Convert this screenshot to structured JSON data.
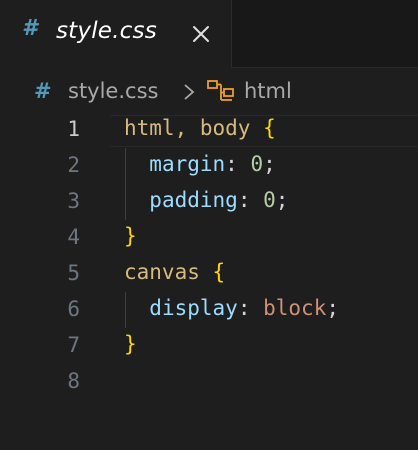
{
  "tab": {
    "icon": "hash-icon",
    "title": "style.css"
  },
  "breadcrumb": {
    "file_icon": "hash-icon",
    "file": "style.css",
    "symbol_icon": "symbol-structure-icon",
    "symbol": "html"
  },
  "editor": {
    "line_numbers": [
      "1",
      "2",
      "3",
      "4",
      "5",
      "6",
      "7",
      "8"
    ],
    "active_line": "1",
    "lines": [
      {
        "sel": "html, body",
        "brace": "{"
      },
      {
        "prop": "margin",
        "colon": ":",
        "num": "0",
        "semi": ";"
      },
      {
        "prop": "padding",
        "colon": ":",
        "num": "0",
        "semi": ";"
      },
      {
        "brace": "}"
      },
      {
        "sel": "canvas",
        "brace": "{"
      },
      {
        "prop": "display",
        "colon": ":",
        "val": "block",
        "semi": ";"
      },
      {
        "brace": "}"
      },
      {}
    ]
  },
  "colors": {
    "background": "#1e1e1e",
    "selector": "#d7ba7d",
    "brace": "#ffd700",
    "property": "#9cdcfe",
    "number": "#b5cea8",
    "value": "#ce9178",
    "css_icon": "#519aba"
  }
}
